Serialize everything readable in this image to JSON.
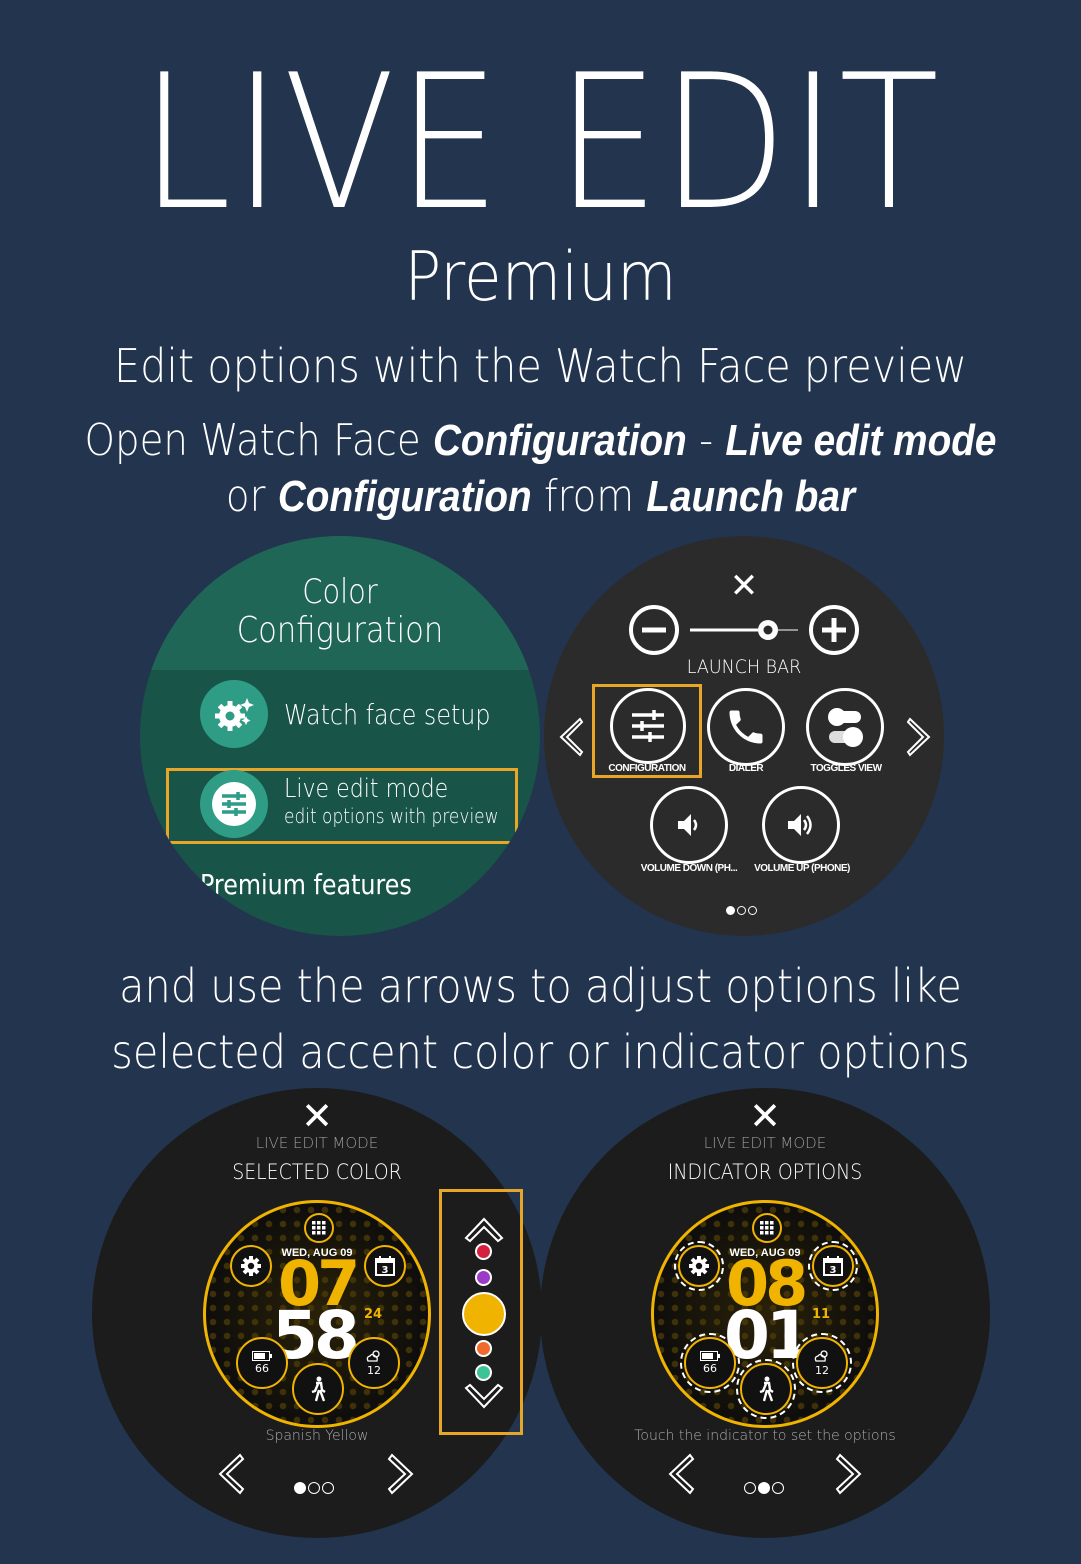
{
  "header": {
    "title": "LIVE EDIT",
    "subtitle": "Premium",
    "line1": "Edit options with the Watch Face preview",
    "line2": {
      "a": "Open Watch Face ",
      "b": "Configuration",
      "c": " - ",
      "d": "Live edit mode"
    },
    "line3": {
      "a": "or ",
      "b": "Configuration",
      "c": " from ",
      "d": "Launch bar"
    },
    "line4": "and use the arrows to adjust options like",
    "line5": "selected accent color or indicator options"
  },
  "color_config": {
    "title_line1": "Color",
    "title_line2": "Configuration",
    "items": [
      {
        "label": "Watch face setup",
        "icon": "gear-sparkle-icon"
      },
      {
        "label": "Live edit mode",
        "sublabel": "edit options with preview",
        "icon": "sliders-icon",
        "highlighted": true
      }
    ],
    "section": "Premium features"
  },
  "launch_bar": {
    "close": "✕",
    "title": "LAUNCH BAR",
    "brightness_level": 0.8,
    "items": [
      {
        "label": "CONFIGURATION",
        "icon": "sliders-icon",
        "highlighted": true
      },
      {
        "label": "DIALER",
        "icon": "phone-icon"
      },
      {
        "label": "TOGGLES VIEW",
        "icon": "toggles-icon"
      },
      {
        "label": "VOLUME DOWN (PH...",
        "icon": "volume-down-icon"
      },
      {
        "label": "VOLUME UP (PHONE)",
        "icon": "volume-up-icon"
      }
    ],
    "page_index": 0,
    "page_count": 3
  },
  "live_edit_color": {
    "close": "✕",
    "mode": "LIVE EDIT MODE",
    "option": "SELECTED COLOR",
    "date": "WED, AUG 09",
    "hour": "07",
    "minute": "58",
    "second": "24",
    "battery": "66",
    "weather": "12",
    "calendar_day": "3",
    "hint": "Spanish Yellow",
    "page_index": 0,
    "page_count": 3,
    "swatches": [
      "#d4213d",
      "#9b3bc8",
      "#f0b400",
      "#ef6a2c",
      "#3cc396"
    ],
    "selected_swatch": 2
  },
  "live_edit_indicator": {
    "close": "✕",
    "mode": "LIVE EDIT MODE",
    "option": "INDICATOR OPTIONS",
    "date": "WED, AUG 09",
    "hour": "08",
    "minute": "01",
    "second": "11",
    "battery": "66",
    "weather": "12",
    "calendar_day": "3",
    "hint": "Touch the indicator to set the options",
    "page_index": 1,
    "page_count": 3
  },
  "colors": {
    "background": "#22344e",
    "accent": "#f0b400",
    "highlight": "#e8a628",
    "teal": "#1f6657"
  }
}
